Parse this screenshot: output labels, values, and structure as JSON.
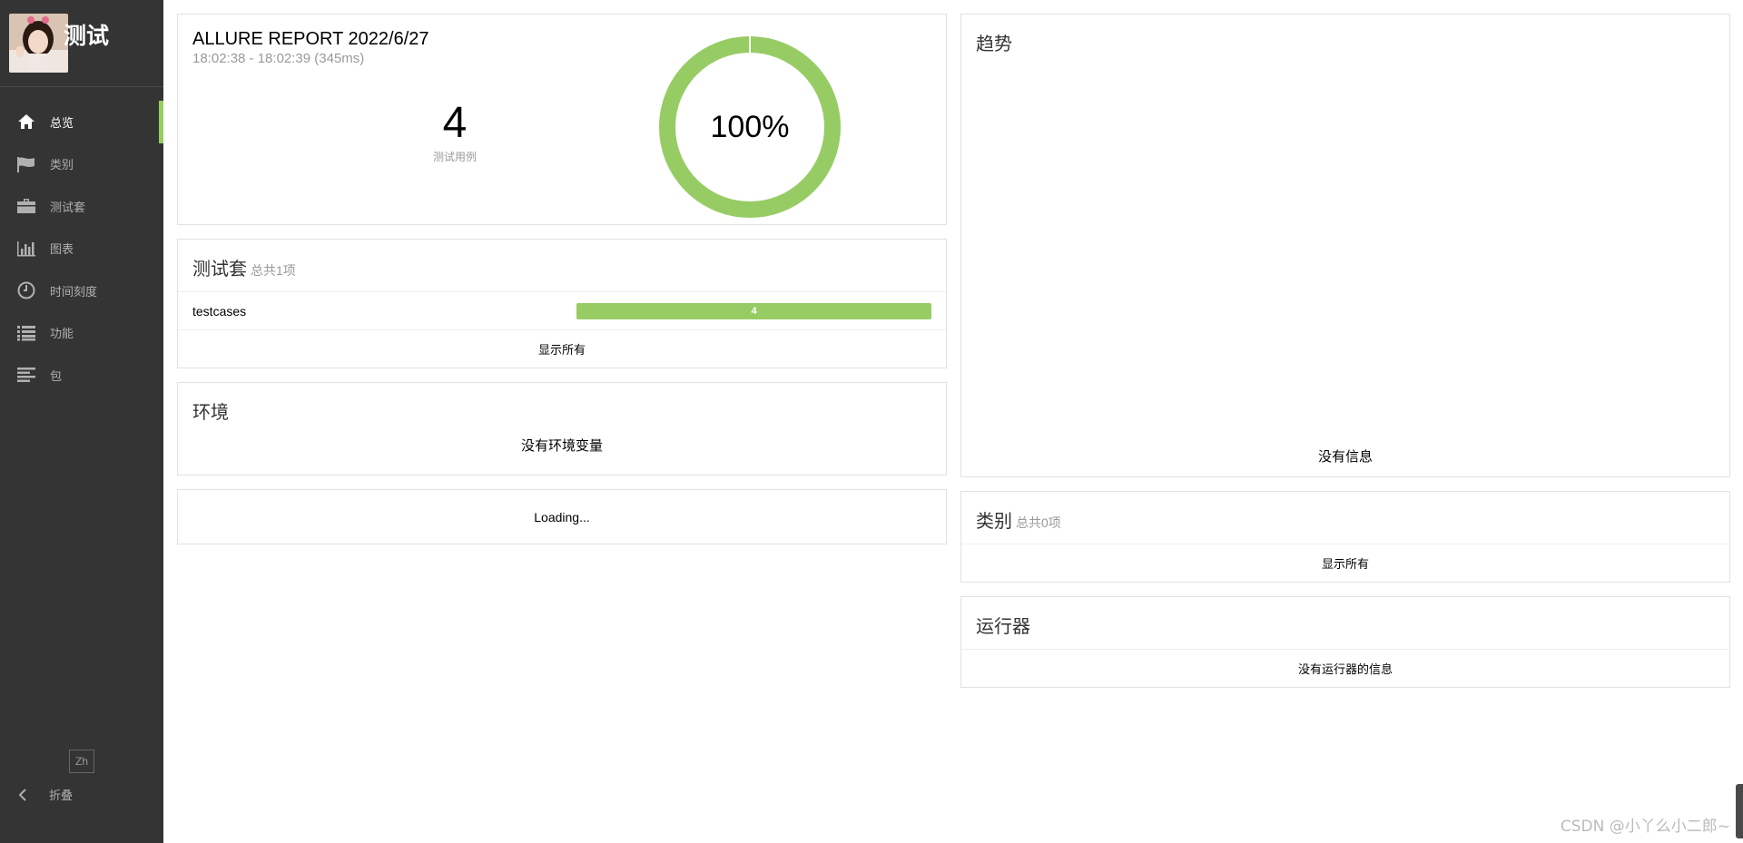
{
  "sidebar": {
    "title": "测试",
    "items": [
      {
        "label": "总览",
        "icon": "home-icon",
        "active": true
      },
      {
        "label": "类别",
        "icon": "flag-icon",
        "active": false
      },
      {
        "label": "测试套",
        "icon": "briefcase-icon",
        "active": false
      },
      {
        "label": "图表",
        "icon": "bar-chart-icon",
        "active": false
      },
      {
        "label": "时间刻度",
        "icon": "clock-icon",
        "active": false
      },
      {
        "label": "功能",
        "icon": "list-icon",
        "active": false
      },
      {
        "label": "包",
        "icon": "align-left-icon",
        "active": false
      }
    ],
    "lang": "Zh",
    "collapse_label": "折叠"
  },
  "summary": {
    "title": "ALLURE REPORT 2022/6/27",
    "time": "18:02:38 - 18:02:39 (345ms)",
    "count": "4",
    "count_label": "测试用例",
    "percent": "100%",
    "passed_fraction": 1.0
  },
  "suites": {
    "title": "测试套",
    "subtitle": "总共1项",
    "rows": [
      {
        "name": "testcases",
        "value": "4",
        "fraction": 1.0
      }
    ],
    "show_all": "显示所有"
  },
  "environment": {
    "title": "环境",
    "empty": "没有环境变量"
  },
  "loading": "Loading...",
  "trend": {
    "title": "趋势",
    "empty": "没有信息"
  },
  "categories": {
    "title": "类别",
    "subtitle": "总共0项",
    "show_all": "显示所有"
  },
  "executors": {
    "title": "运行器",
    "empty": "没有运行器的信息"
  },
  "watermark": "CSDN @小丫么小二郎~",
  "colors": {
    "sidebar_bg": "#343434",
    "passed": "#97cc64",
    "border": "#e2e2e2"
  }
}
